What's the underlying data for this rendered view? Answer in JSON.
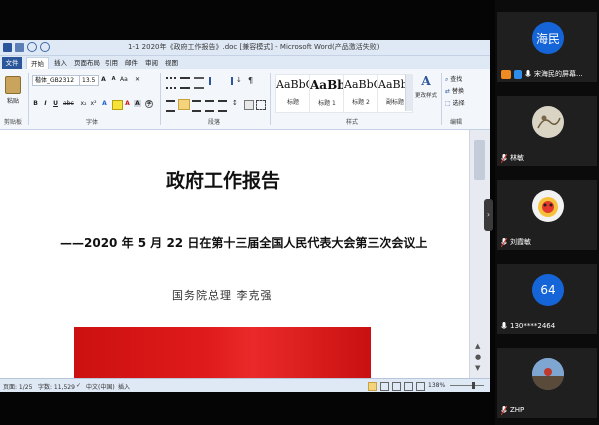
{
  "word": {
    "title": "1-1 2020年《政府工作报告》.doc [兼容模式] - Microsoft Word(产品激活失败)",
    "tabs": [
      "文件",
      "开始",
      "插入",
      "页面布局",
      "引用",
      "邮件",
      "审阅",
      "视图"
    ],
    "font_name": "楷体_GB2312",
    "font_size": "13.5",
    "styles": [
      {
        "sample": "AaBbC",
        "name": "标题"
      },
      {
        "sample": "AaBb",
        "name": "标题 1"
      },
      {
        "sample": "AaBbC",
        "name": "标题 2"
      },
      {
        "sample": "AaBbC",
        "name": "副标题"
      }
    ],
    "change_styles": "更改样式",
    "editing": [
      "查找",
      "替换",
      "选择"
    ],
    "paste": "粘贴",
    "group_labels": {
      "clipboard": "剪贴板",
      "font": "字体",
      "paragraph": "段落",
      "styles": "样式",
      "editing": "编辑"
    },
    "document": {
      "heading": "政府工作报告",
      "subtitle": "——2020 年 5 月 22 日在第十三届全国人民代表大会第三次会议上",
      "author": "国务院总理  李克强",
      "banner_color": "#e01b1b"
    },
    "status": {
      "page": "页面: 1/25",
      "words": "字数: 11,529",
      "language": "中文(中国)",
      "insert_mode": "插入",
      "zoom": "138%"
    }
  },
  "participants": [
    {
      "avatar_text": "海民",
      "name": "宋海民的屏幕...",
      "avatar_color": "#1565d8",
      "sharing": true
    },
    {
      "avatar_text": "",
      "name": "林敏",
      "avatar_color": "#d9d4c4",
      "sharing": false
    },
    {
      "avatar_text": "",
      "name": "刘霞敏",
      "avatar_color": "#f2f2f2",
      "sharing": false
    },
    {
      "avatar_text": "64",
      "name": "130****2464",
      "avatar_color": "#1565d8",
      "sharing": false
    },
    {
      "avatar_text": "",
      "name": "ZHP",
      "avatar_color": "#6a8fb8",
      "sharing": false
    }
  ],
  "colors": {
    "ribbon_accent": "#2b579a",
    "tile_bg": "#1f1f1f"
  }
}
